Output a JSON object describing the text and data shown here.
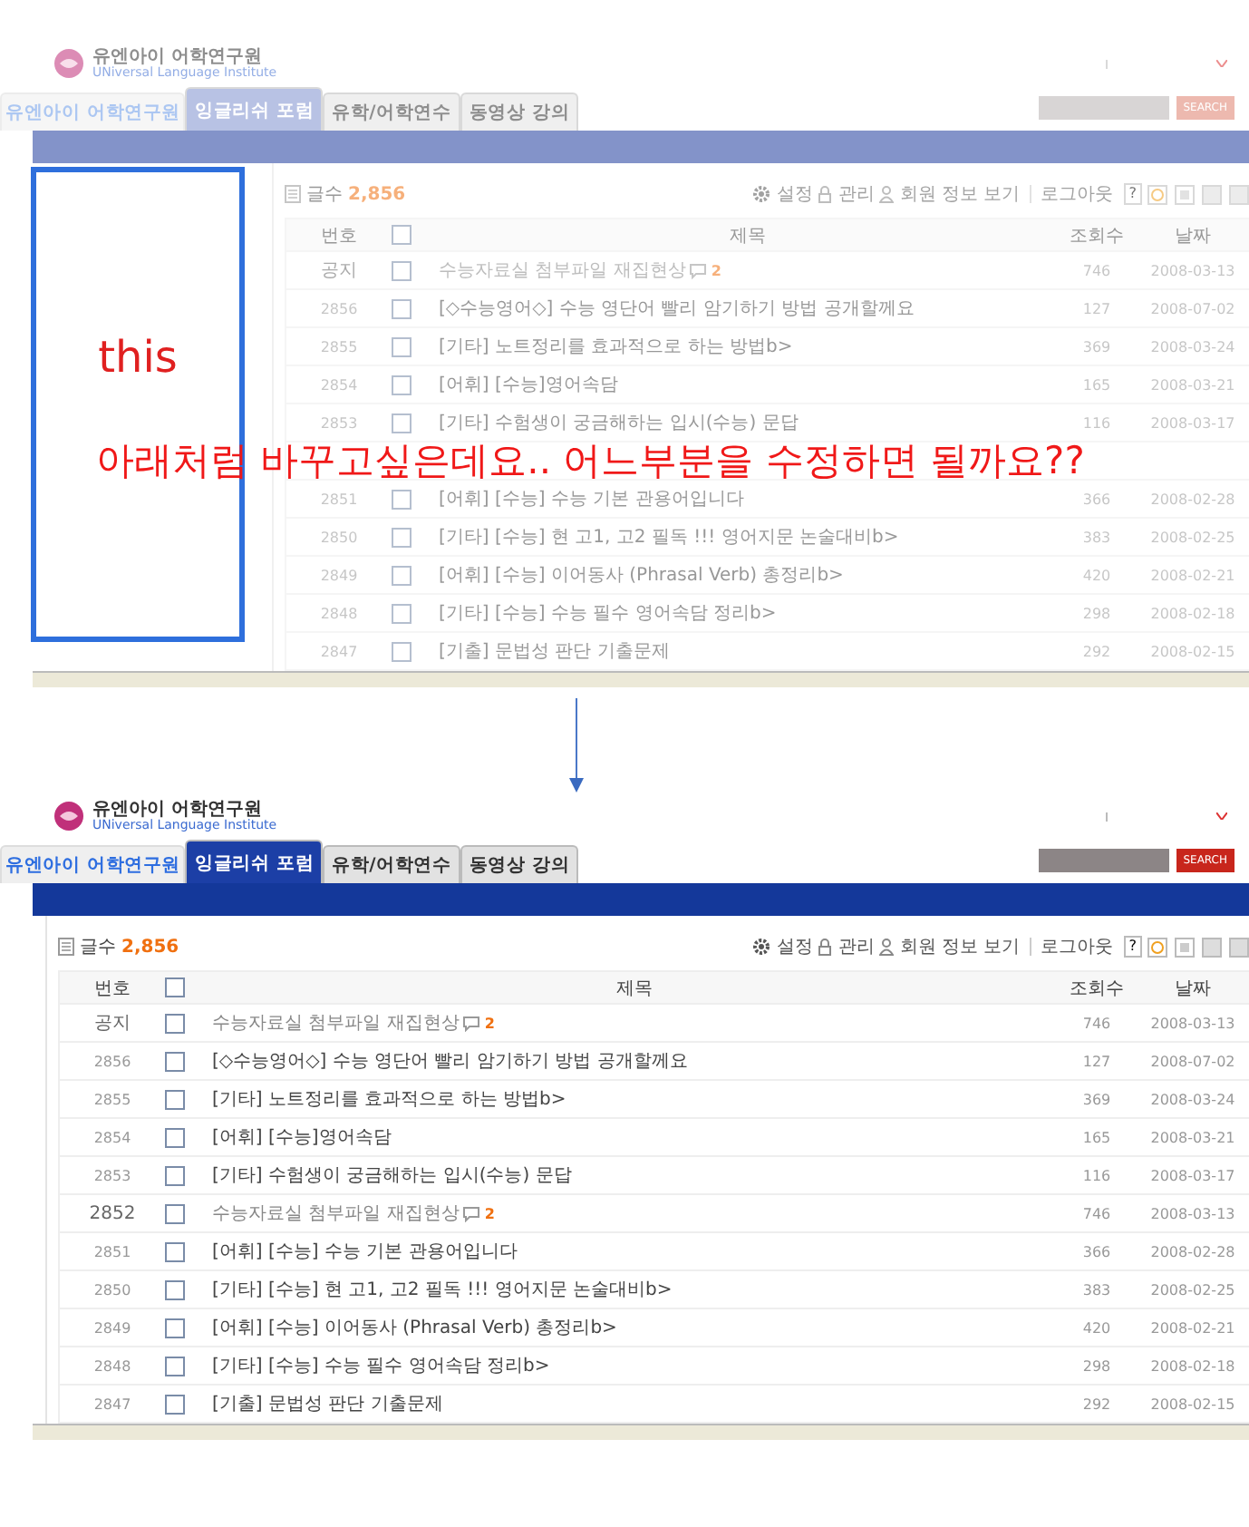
{
  "panels": [
    {
      "kind": "before",
      "logo": {
        "name": "유엔아이 어학연구원",
        "subtitle": "UNiversal Language Institute"
      },
      "tabs": [
        {
          "label": "유엔아이 어학연구원",
          "selected": false
        },
        {
          "label": "잉글리쉬 포럼",
          "selected": true
        },
        {
          "label": "유학/어학연수",
          "selected": false
        },
        {
          "label": "동영상 강의",
          "selected": false
        }
      ],
      "search_button": "SEARCH",
      "annotation": {
        "box_label": "this",
        "note": "아래처럼 바꾸고싶은데요.. 어느부분을 수정하면 될까요??"
      },
      "board": {
        "all_checked": false,
        "count_label": "글수",
        "count": "2,856",
        "toolbar": [
          "설정",
          "관리",
          "회원 정보 보기",
          "로그아웃"
        ],
        "help": "?",
        "columns": [
          "번호",
          "제목",
          "조회수",
          "날짜"
        ],
        "rows": [
          {
            "kind": "notice",
            "checked": false,
            "number": "공지",
            "title": "수능자료실 첨부파일 재집현상",
            "comments": "2",
            "views": "746",
            "date": "2008-03-13"
          },
          {
            "kind": "post",
            "checked": false,
            "number": "2856",
            "title": "[◇수능영어◇] 수능 영단어 빨리 암기하기 방법 공개할께요",
            "views": "127",
            "date": "2008-07-02"
          },
          {
            "kind": "post",
            "checked": false,
            "number": "2855",
            "title": "[기타] 노트정리를 효과적으로 하는 방법b>",
            "views": "369",
            "date": "2008-03-24"
          },
          {
            "kind": "post",
            "checked": false,
            "number": "2854",
            "title": "[어휘] [수능]영어속담",
            "views": "165",
            "date": "2008-03-21"
          },
          {
            "kind": "post",
            "checked": false,
            "number": "2853",
            "title": "[기타] 수험생이 궁금해하는 입시(수능) 문답",
            "views": "116",
            "date": "2008-03-17"
          },
          {
            "kind": "covered"
          },
          {
            "kind": "post",
            "checked": false,
            "number": "2851",
            "title": "[어휘] [수능] 수능 기본 관용어입니다",
            "views": "366",
            "date": "2008-02-28"
          },
          {
            "kind": "post",
            "checked": false,
            "number": "2850",
            "title": "[기타] [수능] 현 고1, 고2 필독 !!! 영어지문 논술대비b>",
            "views": "383",
            "date": "2008-02-25"
          },
          {
            "kind": "post",
            "checked": false,
            "number": "2849",
            "title": "[어휘] [수능] 이어동사 (Phrasal Verb) 총정리b>",
            "views": "420",
            "date": "2008-02-21"
          },
          {
            "kind": "post",
            "checked": false,
            "number": "2848",
            "title": "[기타] [수능] 수능 필수 영어속담 정리b>",
            "views": "298",
            "date": "2008-02-18"
          },
          {
            "kind": "post",
            "checked": false,
            "number": "2847",
            "title": "[기출] 문법성 판단 기출문제",
            "views": "292",
            "date": "2008-02-15"
          }
        ]
      }
    },
    {
      "kind": "after",
      "logo": {
        "name": "유엔아이 어학연구원",
        "subtitle": "UNiversal Language Institute"
      },
      "tabs": [
        {
          "label": "유엔아이 어학연구원",
          "selected": false
        },
        {
          "label": "잉글리쉬 포럼",
          "selected": true
        },
        {
          "label": "유학/어학연수",
          "selected": false
        },
        {
          "label": "동영상 강의",
          "selected": false
        }
      ],
      "search_button": "SEARCH",
      "board": {
        "all_checked": false,
        "count_label": "글수",
        "count": "2,856",
        "toolbar": [
          "설정",
          "관리",
          "회원 정보 보기",
          "로그아웃"
        ],
        "help": "?",
        "columns": [
          "번호",
          "제목",
          "조회수",
          "날짜"
        ],
        "rows": [
          {
            "kind": "notice",
            "checked": false,
            "number": "공지",
            "title": "수능자료실 첨부파일 재집현상",
            "comments": "2",
            "views": "746",
            "date": "2008-03-13"
          },
          {
            "kind": "post",
            "checked": false,
            "number": "2856",
            "title": "[◇수능영어◇] 수능 영단어 빨리 암기하기 방법 공개할께요",
            "views": "127",
            "date": "2008-07-02"
          },
          {
            "kind": "post",
            "checked": false,
            "number": "2855",
            "title": "[기타] 노트정리를 효과적으로 하는 방법b>",
            "views": "369",
            "date": "2008-03-24"
          },
          {
            "kind": "post",
            "checked": false,
            "number": "2854",
            "title": "[어휘] [수능]영어속담",
            "views": "165",
            "date": "2008-03-21"
          },
          {
            "kind": "post",
            "checked": false,
            "number": "2853",
            "title": "[기타] 수험생이 궁금해하는 입시(수능) 문답",
            "views": "116",
            "date": "2008-03-17"
          },
          {
            "kind": "notice",
            "checked": false,
            "number": "2852",
            "title": "수능자료실 첨부파일 재집현상",
            "comments": "2",
            "views": "746",
            "date": "2008-03-13"
          },
          {
            "kind": "post",
            "checked": false,
            "number": "2851",
            "title": "[어휘] [수능] 수능 기본 관용어입니다",
            "views": "366",
            "date": "2008-02-28"
          },
          {
            "kind": "post",
            "checked": false,
            "number": "2850",
            "title": "[기타] [수능] 현 고1, 고2 필독 !!! 영어지문 논술대비b>",
            "views": "383",
            "date": "2008-02-25"
          },
          {
            "kind": "post",
            "checked": false,
            "number": "2849",
            "title": "[어휘] [수능] 이어동사 (Phrasal Verb) 총정리b>",
            "views": "420",
            "date": "2008-02-21"
          },
          {
            "kind": "post",
            "checked": false,
            "number": "2848",
            "title": "[기타] [수능] 수능 필수 영어속담 정리b>",
            "views": "298",
            "date": "2008-02-18"
          },
          {
            "kind": "post",
            "checked": false,
            "number": "2847",
            "title": "[기출] 문법성 판단 기출문제",
            "views": "292",
            "date": "2008-02-15"
          }
        ]
      }
    }
  ]
}
